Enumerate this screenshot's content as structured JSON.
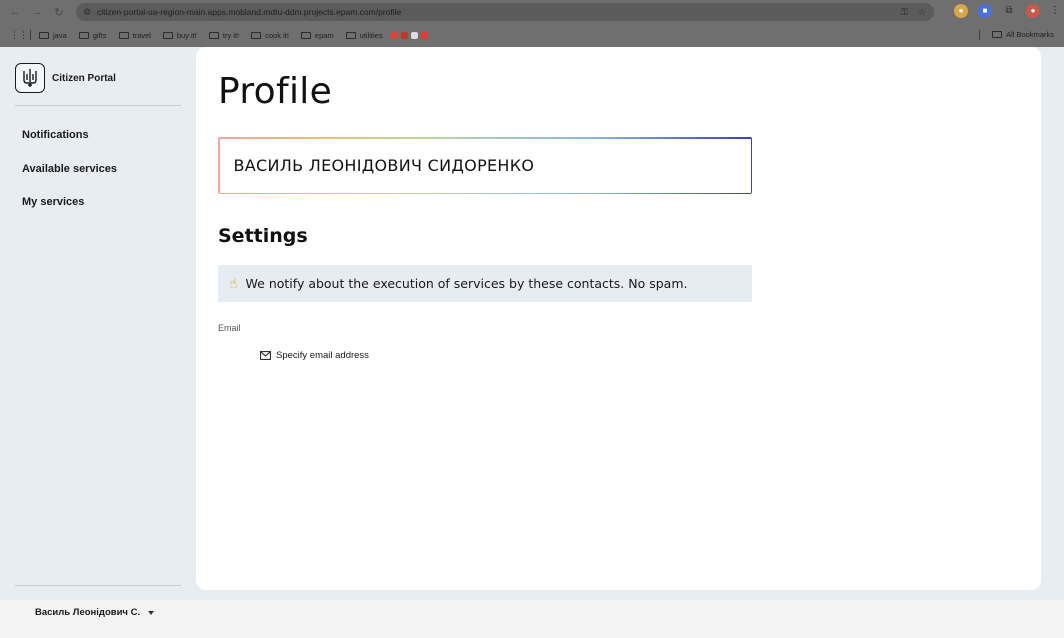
{
  "browser": {
    "url": "citizen-portal-ua-region-main.apps.mobland.mdtu-ddm.projects.epam.com/profile",
    "bookmarks": [
      "java",
      "gifts",
      "travel",
      "buy it!",
      "try it!",
      "cook it!",
      "epam",
      "utilities"
    ],
    "all_bookmarks_label": "All Bookmarks"
  },
  "sidebar": {
    "brand": "Citizen Portal",
    "nav": [
      {
        "label": "Notifications"
      },
      {
        "label": "Available services"
      },
      {
        "label": "My services"
      }
    ]
  },
  "user": {
    "short_name": "Василь Леонідович С."
  },
  "main": {
    "title": "Profile",
    "full_name": "ВАСИЛЬ ЛЕОНІДОВИЧ СИДОРЕНКО",
    "settings_title": "Settings",
    "notice_icon": "☝",
    "notice_text": "We notify about the execution of services by these contacts. No spam.",
    "email_label": "Email",
    "email_action": "Specify email address"
  },
  "colors": {
    "sidebar_bg": "#e8edf2",
    "content_bg": "#ffffff",
    "notice_bg": "#e6ecf2",
    "gradient_end": "#3a3ec8"
  }
}
